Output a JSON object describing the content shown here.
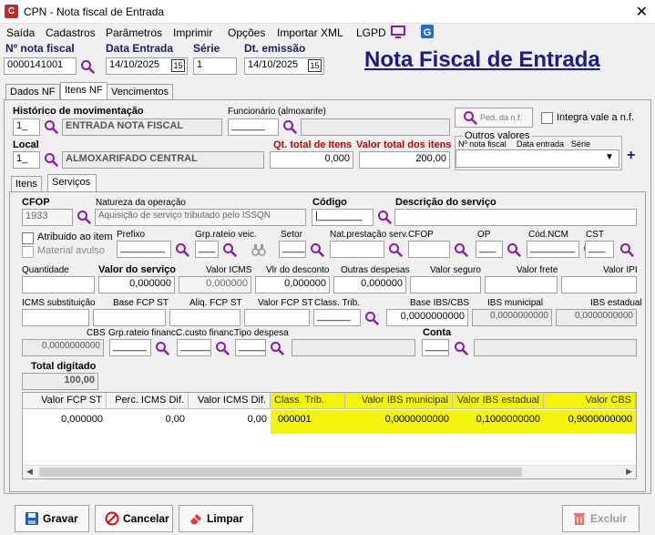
{
  "window": {
    "title": "CPN - Nota fiscal de Entrada",
    "close": "✕",
    "app_icon_letter": "C"
  },
  "menu": [
    "Saída",
    "Cadastros",
    "Parâmetros",
    "Imprimir",
    "Opções",
    "Importar XML",
    "LGPD"
  ],
  "header": {
    "nota_label": "Nº nota fiscal",
    "nota_value": "0000141001",
    "data_entrada_label": "Data Entrada",
    "data_entrada_value": "14/10/2025",
    "serie_label": "Série",
    "serie_value": "1",
    "dt_emissao_label": "Dt. emissão",
    "dt_emissao_value": "14/10/2025",
    "page_title": "Nota Fiscal de Entrada",
    "cal_glyph": "15"
  },
  "tabs": [
    "Dados NF",
    "Itens NF",
    "Vencimentos"
  ],
  "itens_nf": {
    "historico_label": "Histórico de movimentação",
    "historico_code": "1_",
    "historico_desc": "ENTRADA NOTA FISCAL",
    "funcionario_label": "Funcionário (almoxarife)",
    "funcionario_value": "______",
    "ped_button": "Ped. da n.f.",
    "integra_label": "Integra vale a n.f.",
    "local_label": "Local",
    "local_code": "1_",
    "local_desc": "ALMOXARIFADO CENTRAL",
    "qt_total_label": "Qt. total de Itens",
    "qt_total_value": "0,000",
    "valor_total_label": "Valor total dos itens",
    "valor_total_value": "200,00",
    "outros_label": "Outros valores",
    "outros_cols": [
      "Nº nota fiscal",
      "Data entrada",
      "Série"
    ],
    "plus": "+"
  },
  "subtabs": [
    "Itens",
    "Serviços"
  ],
  "servicos": {
    "cfop_label": "CFOP",
    "cfop_value": "1933",
    "natureza_label": "Natureza da operação",
    "natureza_value": "Aquisição de serviço tributado pelo ISSQN",
    "codigo_label": "Código",
    "codigo_value": "|________",
    "descricao_label": "Descrição do serviço",
    "atribuido_label": "Atribuido ao item",
    "material_label": "Material avulso",
    "prefixo_label": "Prefixo",
    "prefixo_value": "________",
    "grp_rateio_label": "Grp.rateio veic.",
    "grp_rateio_value": "___",
    "setor_label": "Setor",
    "setor_value": "____",
    "nat_prest_label": "Nat.prestação serv.",
    "cfop2_label": "CFOP",
    "op_label": "OP",
    "op_value": "___",
    "cod_ncm_label": "Cód.NCM",
    "cod_ncm_value": "________",
    "cst_label": "CST",
    "cst_value": "___",
    "quantidade_label": "Quantidade",
    "valor_servico_label": "Valor do serviço",
    "valor_servico_value": "0,000000",
    "valor_icms_label": "Valor ICMS",
    "valor_icms_value": "0,000000",
    "vlr_desconto_label": "Vlr do desconto",
    "vlr_desconto_value": "0,000000",
    "outras_desp_label": "Outras despesas",
    "outras_desp_value": "0,000000",
    "valor_seguro_label": "Valor seguro",
    "valor_frete_label": "Valor frete",
    "valor_ipi_label": "Valor IPI",
    "icms_subst_label": "ICMS substituição",
    "base_fcp_label": "Base FCP ST",
    "aliq_fcp_label": "Aliq. FCP ST",
    "valor_fcp_label": "Valor FCP ST",
    "class_trib_label": "Class. Trib.",
    "class_trib_value": "______",
    "base_ibs_label": "Base IBS/CBS",
    "base_ibs_value": "0,0000000000",
    "ibs_mun_label": "IBS municipal",
    "ibs_mun_value": "0,0000000000",
    "ibs_est_label": "IBS estadual",
    "ibs_est_value": "0,0000000000",
    "cbs_label": "CBS",
    "cbs_value": "0,0000000000",
    "grp_rateio_fin_label": "Grp.rateio financ.",
    "grp_rateio_fin_value": "______",
    "c_custo_label": "C.custo financ.",
    "c_custo_value": "______",
    "tipo_despesa_label": "Tipo despesa",
    "tipo_despesa_value": "_____",
    "conta_label": "Conta",
    "conta_value": "_____",
    "total_digitado_label": "Total digitado",
    "total_digitado_value": "100,00"
  },
  "grid": {
    "headers": [
      "Valor FCP ST",
      "Perc. ICMS Dif.",
      "Valor ICMS Dif.",
      "Class. Trib.",
      "Valor IBS municipal",
      "Valor IBS estadual",
      "Valor CBS"
    ],
    "row": [
      "0,000000",
      "0,00",
      "0,00",
      "000001",
      "0,0000000000",
      "0,1000000000",
      "0,9000000000"
    ],
    "highlight": "#f4f40a"
  },
  "buttons": {
    "gravar": "Gravar",
    "cancelar": "Cancelar",
    "limpar": "Limpar",
    "excluir": "Excluir"
  },
  "colors": {
    "accent": "#1a1a8a",
    "required": "#c00000",
    "magnifier": "#8a1aa8"
  }
}
